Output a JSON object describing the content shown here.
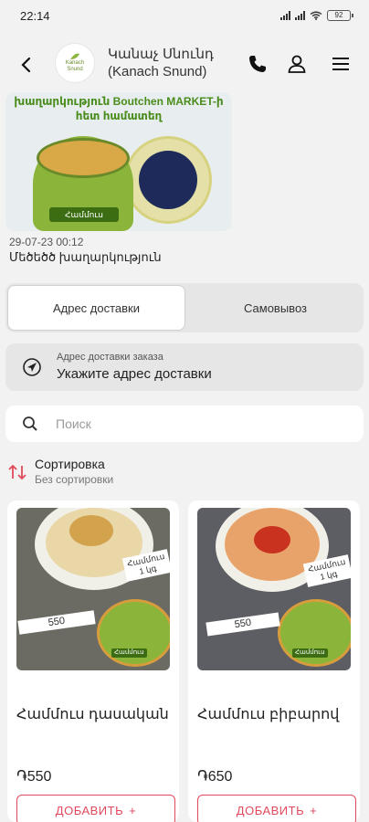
{
  "status": {
    "time": "22:14",
    "battery": "92"
  },
  "header": {
    "shop_name_line1": "Կանաչ Սնունդ",
    "shop_name_line2": "(Kanach Snund)",
    "logo_line1": "Kanach",
    "logo_line2": "Snund"
  },
  "post": {
    "banner_line1": "խաղարկություն Boutchen MARKET-ի",
    "banner_line2": "հետ համատեղ",
    "pack_label": "Համմուս",
    "date": "29-07-23 00:12",
    "title": "Մեծեծծ խաղարկություն"
  },
  "delivery_tabs": [
    {
      "label": "Адрес доставки",
      "active": true
    },
    {
      "label": "Самовывоз",
      "active": false
    }
  ],
  "address": {
    "label": "Адрес доставки заказа",
    "value": "Укажите адрес доставки"
  },
  "search": {
    "placeholder": "Поиск"
  },
  "sort": {
    "title": "Сортировка",
    "value": "Без сортировки"
  },
  "products": [
    {
      "name": "Համմուս դասական",
      "price": "֏550",
      "tag_price": "550",
      "add_label": "ДОБАВИТЬ"
    },
    {
      "name": "Համմուս բիբարով",
      "price": "֏650",
      "tag_price": "550",
      "add_label": "ДОБАВИТЬ"
    }
  ],
  "colors": {
    "accent": "#e04a5c",
    "brand_green": "#4a8c1c"
  }
}
